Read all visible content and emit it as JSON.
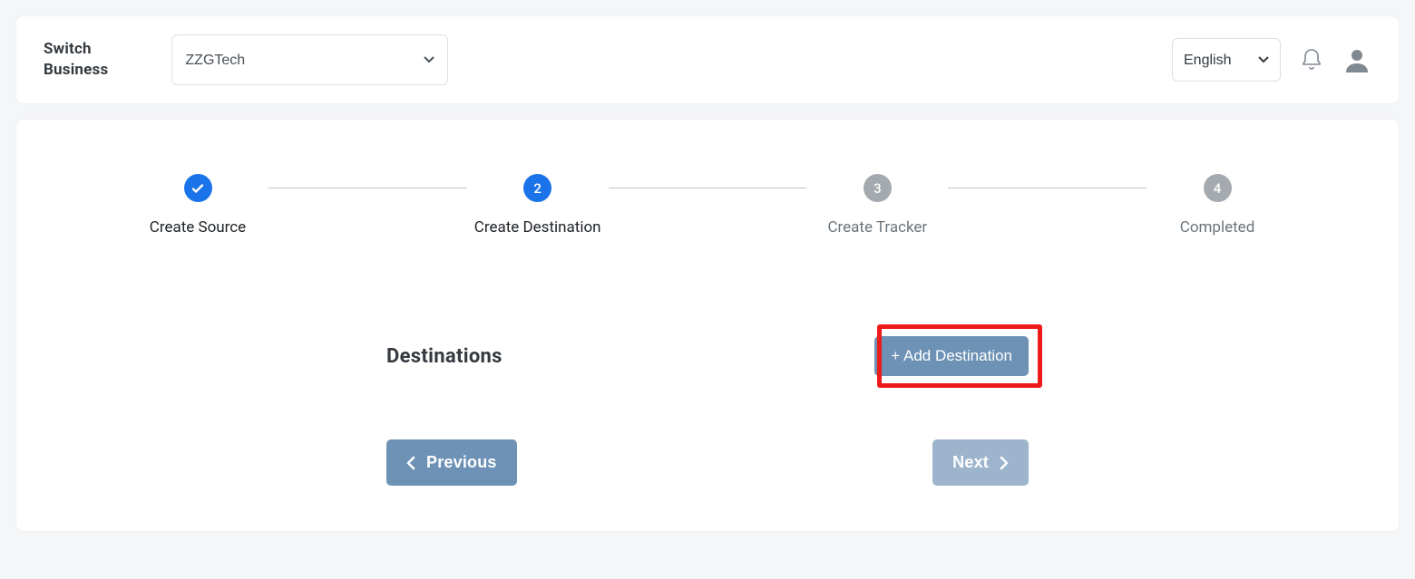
{
  "header": {
    "switch_business_label": "Switch\nBusiness",
    "business_selected": "ZZGTech",
    "language_selected": "English"
  },
  "stepper": {
    "steps": [
      {
        "num": "",
        "label": "Create Source",
        "state": "complete"
      },
      {
        "num": "2",
        "label": "Create Destination",
        "state": "active"
      },
      {
        "num": "3",
        "label": "Create Tracker",
        "state": "pending"
      },
      {
        "num": "4",
        "label": "Completed",
        "state": "pending"
      }
    ]
  },
  "main": {
    "section_title": "Destinations",
    "add_button_label": "+ Add Destination"
  },
  "nav": {
    "previous_label": "Previous",
    "next_label": "Next"
  }
}
